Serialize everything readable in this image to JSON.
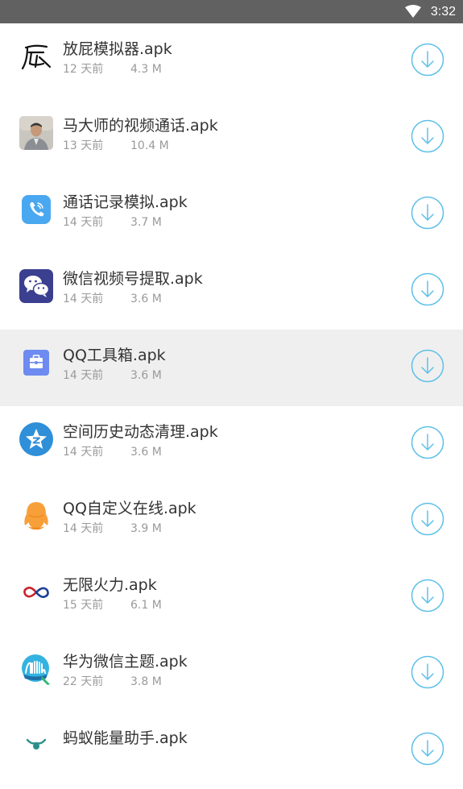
{
  "status_bar": {
    "time": "3:32",
    "wifi_icon": "wifi-icon"
  },
  "files": [
    {
      "name": "放屁模拟器.apk",
      "age": "12 天前",
      "size": "4.3 M",
      "icon": "fart-calligraphy-icon"
    },
    {
      "name": "马大师的视频通话.apk",
      "age": "13 天前",
      "size": "10.4 M",
      "icon": "portrait-photo-icon"
    },
    {
      "name": "通话记录模拟.apk",
      "age": "14 天前",
      "size": "3.7 M",
      "icon": "phone-call-icon"
    },
    {
      "name": "微信视频号提取.apk",
      "age": "14 天前",
      "size": "3.6 M",
      "icon": "wechat-icon"
    },
    {
      "name": "QQ工具箱.apk",
      "age": "14 天前",
      "size": "3.6 M",
      "icon": "toolbox-icon"
    },
    {
      "name": "空间历史动态清理.apk",
      "age": "14 天前",
      "size": "3.6 M",
      "icon": "qzone-star-icon"
    },
    {
      "name": "QQ自定义在线.apk",
      "age": "14 天前",
      "size": "3.9 M",
      "icon": "qq-penguin-icon"
    },
    {
      "name": "无限火力.apk",
      "age": "15 天前",
      "size": "6.1 M",
      "icon": "infinity-icon"
    },
    {
      "name": "华为微信主题.apk",
      "age": "22 天前",
      "size": "3.8 M",
      "icon": "theme-brush-icon"
    },
    {
      "name": "蚂蚁能量助手.apk",
      "age": "",
      "size": "",
      "icon": "ant-icon"
    }
  ],
  "selected_index": 4,
  "colors": {
    "status_bar": "#616161",
    "download_accent": "#5ec0e8",
    "selected_row": "#efefef"
  }
}
